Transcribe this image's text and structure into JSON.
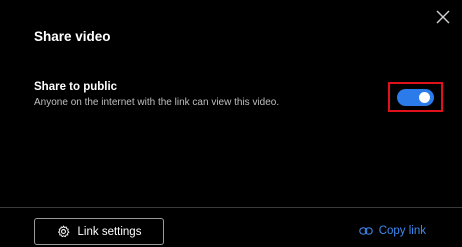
{
  "dialog": {
    "title": "Share video",
    "close_icon": "close-icon"
  },
  "share_public": {
    "label": "Share to public",
    "description": "Anyone on the internet with the link can view this video.",
    "enabled": true
  },
  "footer": {
    "link_settings_label": "Link settings",
    "link_settings_icon": "gear-icon",
    "copy_link_label": "Copy link",
    "copy_link_icon": "link-icon"
  },
  "colors": {
    "background": "#000000",
    "toggle_on": "#2b7bea",
    "highlight": "#e0111b",
    "link": "#3d8bf0"
  }
}
